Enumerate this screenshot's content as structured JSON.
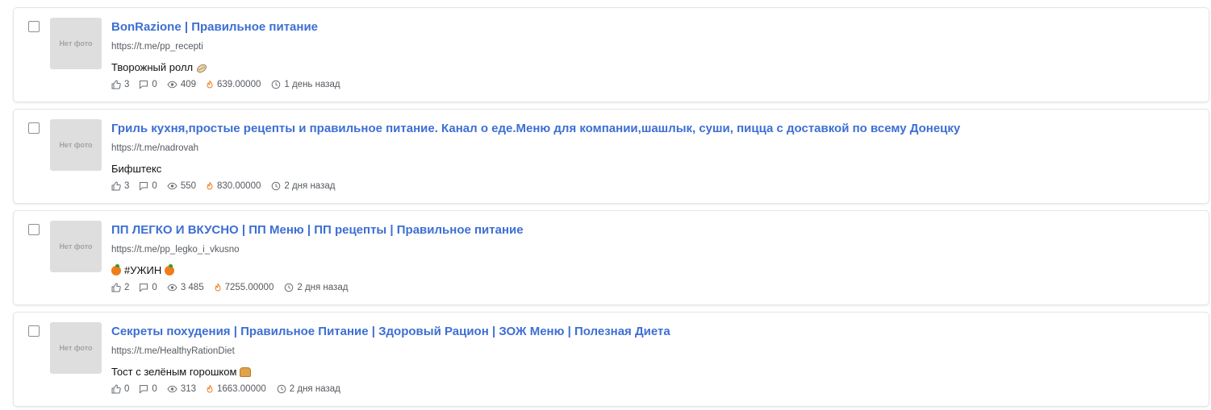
{
  "thumb_label": "Нет фото",
  "accent_color": "#3d6fd3",
  "posts": [
    {
      "title": "BonRazione | Правильное питание",
      "url": "https://t.me/pp_recepti",
      "text": "Творожный ролл",
      "text_emoji": "roll-emoji-icon",
      "likes": "3",
      "comments": "0",
      "views": "409",
      "score": "639.00000",
      "time": "1 день назад"
    },
    {
      "title": "Гриль кухня,простые рецепты и правильное питание. Канал о еде.Меню для компании,шашлык, суши, пицца с доставкой по всему Донецку",
      "url": "https://t.me/nadrovah",
      "text": "Бифштекс",
      "text_emoji": "",
      "likes": "3",
      "comments": "0",
      "views": "550",
      "score": "830.00000",
      "time": "2 дня назад"
    },
    {
      "title": "ПП ЛЕГКО И ВКУСНО | ПП Меню | ПП рецепты | Правильное питание",
      "url": "https://t.me/pp_legko_i_vkusno",
      "text": "#УЖИН",
      "text_emoji": "tangerine-emoji-icon",
      "likes": "2",
      "comments": "0",
      "views": "3 485",
      "score": "7255.00000",
      "time": "2 дня назад"
    },
    {
      "title": "Секреты похудения | Правильное Питание | Здоровый Рацион | ЗОЖ Меню | Полезная Диета",
      "url": "https://t.me/HealthyRationDiet",
      "text": "Тост с зелёным горошком",
      "text_emoji": "bread-emoji-icon",
      "likes": "0",
      "comments": "0",
      "views": "313",
      "score": "1663.00000",
      "time": "2 дня назад"
    }
  ]
}
